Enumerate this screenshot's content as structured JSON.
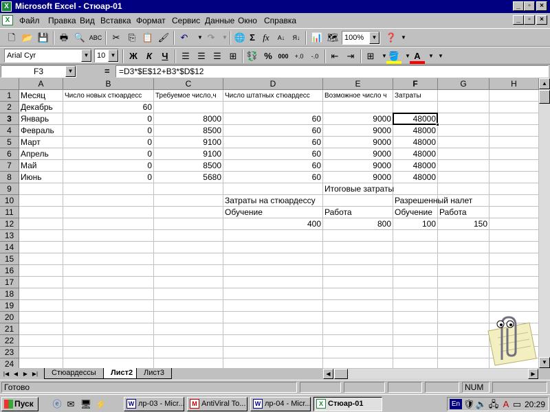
{
  "window": {
    "title": "Microsoft Excel - Стюар-01",
    "app_icon": "excel-icon"
  },
  "menu": {
    "items": [
      "Файл",
      "Правка",
      "Вид",
      "Вставка",
      "Формат",
      "Сервис",
      "Данные",
      "Окно",
      "Справка"
    ]
  },
  "toolbar": {
    "zoom": "100%",
    "font_name": "Arial Cyr",
    "font_size": "10",
    "bold": "Ж",
    "italic": "К",
    "underline": "Ч",
    "currency": "%",
    "thousands": "000"
  },
  "formula_bar": {
    "name_box": "F3",
    "eq": "=",
    "formula": "=D3*$E$12+B3*$D$12"
  },
  "columns": [
    "A",
    "B",
    "C",
    "D",
    "E",
    "F",
    "G",
    "H"
  ],
  "rows": [
    "1",
    "2",
    "3",
    "4",
    "5",
    "6",
    "7",
    "8",
    "9",
    "10",
    "11",
    "12",
    "13",
    "14",
    "15",
    "16",
    "17",
    "18",
    "19",
    "20",
    "21",
    "22",
    "23",
    "24"
  ],
  "cells": {
    "A1": "Месяц",
    "B1": "Число новых стюардесс",
    "C1": "Требуемое число,ч",
    "D1": "Число штатных стюардесс",
    "E1": "Возможное число ч",
    "F1": "Затраты",
    "A2": "Декабрь",
    "B2": "60",
    "A3": "Январь",
    "B3": "0",
    "C3": "8000",
    "D3": "60",
    "E3": "9000",
    "F3": "48000",
    "A4": "Февраль",
    "B4": "0",
    "C4": "8500",
    "D4": "60",
    "E4": "9000",
    "F4": "48000",
    "A5": "Март",
    "B5": "0",
    "C5": "9100",
    "D5": "60",
    "E5": "9000",
    "F5": "48000",
    "A6": "Апрель",
    "B6": "0",
    "C6": "9100",
    "D6": "60",
    "E6": "9000",
    "F6": "48000",
    "A7": "Май",
    "B7": "0",
    "C7": "8500",
    "D7": "60",
    "E7": "9000",
    "F7": "48000",
    "A8": "Июнь",
    "B8": "0",
    "C8": "5680",
    "D8": "60",
    "E8": "9000",
    "F8": "48000",
    "E9": "Итоговые затраты",
    "D10": "Затраты на стюардессу",
    "F10": "Разрешенный налет",
    "D11": "Обучение",
    "E11": "Работа",
    "F11": "Обучение",
    "G11": "Работа",
    "D12": "400",
    "E12": "800",
    "F12": "100",
    "G12": "150"
  },
  "sheet_tabs": [
    "Стюардессы",
    "Лист2",
    "Лист3"
  ],
  "active_sheet": "Лист2",
  "status": {
    "ready": "Готово",
    "num": "NUM"
  },
  "taskbar": {
    "start": "Пуск",
    "buttons": [
      "лр-03 - Micr...",
      "AntiViral To...",
      "лр-04 - Micr...",
      "Стюар-01"
    ],
    "lang": "En",
    "clock": "20:29"
  }
}
